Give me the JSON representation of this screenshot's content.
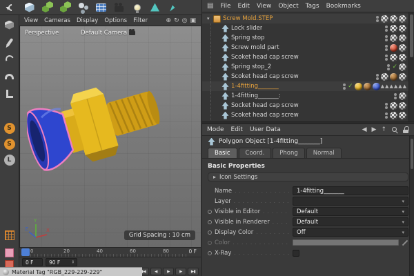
{
  "colors": {
    "accent_orange": "#e8a33d",
    "selection_blue": "#4d7fd6"
  },
  "icons_reference": {
    "top_toolbar": [
      "undo-icon",
      "cube-icon",
      "cubes-stack-icon",
      "instances-icon",
      "spheres-icon",
      "table-icon",
      "camera-icon",
      "light-bulb-icon",
      "triangle-tool-icon",
      "pen-tool-icon"
    ],
    "left_toolbar": [
      "cube-tool-icon",
      "pen-tool-icon",
      "spline-tool-icon",
      "arch-tool-icon",
      "bracket-tool-icon",
      "s-badge-icon",
      "s-badge-icon",
      "l-badge-icon",
      "axis-grid-icon",
      "plane-icon",
      "uv-plane-icon"
    ]
  },
  "left_toolbar": {
    "badges": [
      "S",
      "S",
      "L"
    ]
  },
  "viewport": {
    "menu": [
      "View",
      "Cameras",
      "Display",
      "Options",
      "Filter"
    ],
    "corner_icons": [
      {
        "name": "pan-view-icon",
        "glyph": "⊕"
      },
      {
        "name": "orbit-view-icon",
        "glyph": "↻"
      },
      {
        "name": "zoom-view-icon",
        "glyph": "◎"
      },
      {
        "name": "maximize-view-icon",
        "glyph": "▣"
      }
    ],
    "perspective_label": "Perspective",
    "camera_label": "Default Camera",
    "grid_spacing_label": "Grid Spacing : 10 cm",
    "axis": {
      "x": "X",
      "y": "Y",
      "z": "Z"
    }
  },
  "timeline": {
    "ticks": [
      "0",
      "20",
      "40",
      "60",
      "80"
    ],
    "ruler_current_label": "0 F",
    "start_field": "0 F",
    "end_field": "90 F",
    "transport": [
      {
        "name": "goto-start-button",
        "glyph": "▮◀"
      },
      {
        "name": "prev-frame-button",
        "glyph": "◀"
      },
      {
        "name": "play-button",
        "glyph": "▶"
      },
      {
        "name": "next-frame-button",
        "glyph": "▶"
      },
      {
        "name": "goto-end-button",
        "glyph": "▶▮"
      }
    ]
  },
  "object_manager": {
    "menu": [
      "File",
      "Edit",
      "View",
      "Object",
      "Tags",
      "Bookmarks"
    ],
    "burger_glyph": "▤",
    "expander_glyph": "▾",
    "check_glyph": "✓",
    "selection_tag_glyph": "▲",
    "items": [
      {
        "label": "Screw Mold.STEP",
        "indent": 0,
        "color": "orange",
        "icon": "step-file-icon",
        "materials": [
          "checker",
          "checker",
          "checker"
        ]
      },
      {
        "label": "Lock slider",
        "indent": 1,
        "materials": [
          "checker",
          "checker"
        ]
      },
      {
        "label": "Spring stop",
        "indent": 1,
        "materials": [
          "checker",
          "checker"
        ]
      },
      {
        "label": "Screw mold part",
        "indent": 1,
        "materials": [
          "red",
          "checker"
        ]
      },
      {
        "label": "Scoket head cap screw",
        "indent": 1,
        "materials": [
          "checker",
          "checker"
        ]
      },
      {
        "label": "Spring stop_2",
        "indent": 1,
        "check": true,
        "materials": [
          "checker"
        ]
      },
      {
        "label": "Scoket head cap screw",
        "indent": 1,
        "materials": [
          "checker",
          "brown",
          "checker"
        ]
      },
      {
        "label": "1-4fitting_______",
        "indent": 1,
        "color": "orange",
        "check": true,
        "materials": [
          "gold",
          "brown",
          "blue"
        ],
        "triangles": 6
      },
      {
        "label": "1-4fitting_______:",
        "indent": 1,
        "materials": [
          "checker"
        ]
      },
      {
        "label": "Socket head cap screw",
        "indent": 1,
        "materials": [
          "checker",
          "checker"
        ]
      },
      {
        "label": "Scoket head cap screw",
        "indent": 1,
        "materials": [
          "checker",
          "checker"
        ]
      }
    ]
  },
  "attributes": {
    "menu": [
      "Mode",
      "Edit",
      "User Data"
    ],
    "menu_icons": [
      {
        "name": "back-icon",
        "glyph": "◀"
      },
      {
        "name": "forward-icon",
        "glyph": "▶"
      },
      {
        "name": "up-icon",
        "glyph": "↑"
      },
      {
        "name": "search-icon",
        "glyph": ""
      },
      {
        "name": "lock-icon",
        "glyph": ""
      }
    ],
    "title": "Polygon Object [1-4fitting_______]",
    "tabs": [
      {
        "label": "Basic",
        "active": true
      },
      {
        "label": "Coord.",
        "active": false
      },
      {
        "label": "Phong",
        "active": false
      },
      {
        "label": "Normal",
        "active": false
      }
    ],
    "section_title": "Basic Properties",
    "group_label": "Icon Settings",
    "expand_glyph": "▸",
    "dd_arrow": "▾",
    "fields": {
      "name": {
        "label": "Name",
        "value": "1-4fitting_______"
      },
      "layer": {
        "label": "Layer",
        "value": ""
      },
      "visible_editor": {
        "label": "Visible in Editor",
        "value": "Default"
      },
      "visible_renderer": {
        "label": "Visible in Renderer",
        "value": "Default"
      },
      "display_color": {
        "label": "Display Color",
        "value": "Off"
      },
      "color": {
        "label": "Color",
        "value": ""
      },
      "xray": {
        "label": "X-Ray",
        "checked": false
      }
    }
  },
  "status_bar": {
    "text": "Material Tag \"RGB_229-229-229\""
  }
}
